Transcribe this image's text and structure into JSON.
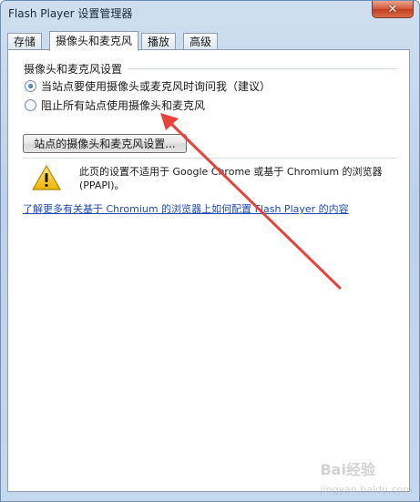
{
  "window": {
    "title": "Flash Player 设置管理器",
    "close_label": "✕"
  },
  "tabs": [
    {
      "label": "存储"
    },
    {
      "label": "摄像头和麦克风"
    },
    {
      "label": "播放"
    },
    {
      "label": "高级"
    }
  ],
  "camera_mic": {
    "group_title": "摄像头和麦克风设置",
    "options": [
      {
        "label": "当站点要使用摄像头或麦克风时询问我（建议）",
        "checked": true
      },
      {
        "label": "阻止所有站点使用摄像头和麦克风",
        "checked": false
      }
    ],
    "site_settings_button": "站点的摄像头和麦克风设置...",
    "notice": "此页的设置不适用于 Google Chrome 或基于 Chromium 的浏览器 (PPAPI)。",
    "help_link": "了解更多有关基于 Chromium 的浏览器上如何配置 Flash Player 的内容"
  },
  "annotation": {
    "arrow_color": "#e8423c"
  },
  "watermark": {
    "brand": "Bai",
    "brand2": "经验",
    "sub": "jingyan.baidu.com"
  }
}
